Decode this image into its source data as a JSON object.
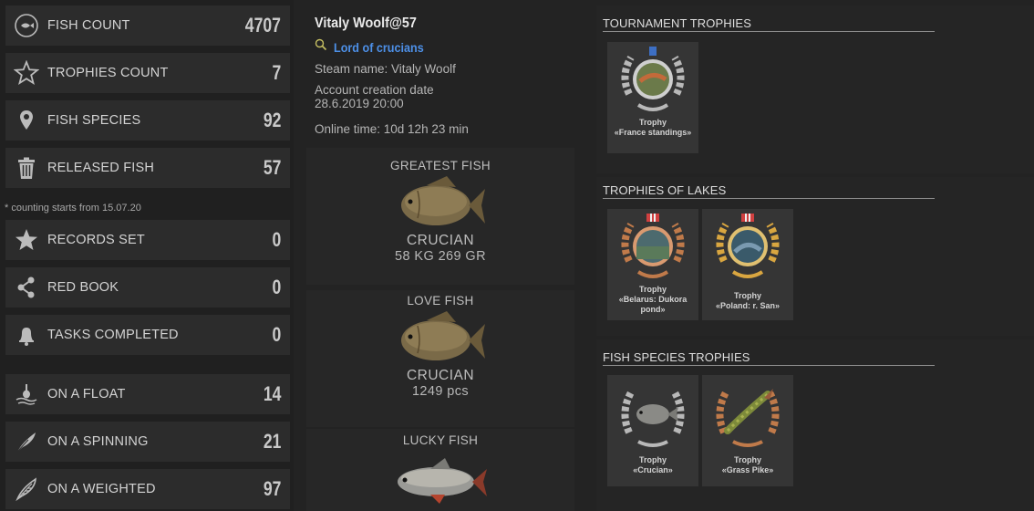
{
  "stats": {
    "fish_count": {
      "label": "FISH COUNT",
      "value": "4707",
      "icon": "fish-icon"
    },
    "trophies_count": {
      "label": "TROPHIES COUNT",
      "value": "7",
      "icon": "star-outline-icon"
    },
    "fish_species": {
      "label": "FISH SPECIES",
      "value": "92",
      "icon": "map-pin-icon"
    },
    "released_fish": {
      "label": "RELEASED FISH",
      "value": "57",
      "icon": "trash-icon"
    },
    "note": "* counting starts from 15.07.20",
    "records_set": {
      "label": "RECORDS SET",
      "value": "0",
      "icon": "star-filled-icon"
    },
    "red_book": {
      "label": "RED BOOK",
      "value": "0",
      "icon": "share-icon"
    },
    "tasks_completed": {
      "label": "TASKS COMPLETED",
      "value": "0",
      "icon": "bell-icon"
    },
    "on_a_float": {
      "label": "ON A FLOAT",
      "value": "14",
      "icon": "float-icon"
    },
    "on_a_spinning": {
      "label": "ON A SPINNING",
      "value": "21",
      "icon": "feather-icon"
    },
    "on_a_weighted": {
      "label": "ON A WEIGHTED",
      "value": "97",
      "icon": "feather-weighted-icon"
    }
  },
  "profile": {
    "name": "Vitaly Woolf@57",
    "title": "Lord of crucians",
    "steam_name": "Steam name: Vitaly Woolf",
    "creation_label": "Account creation date",
    "creation_date": "28.6.2019 20:00",
    "online_time": "Online time: 10d 12h 23 min"
  },
  "fish": {
    "greatest": {
      "caption": "GREATEST FISH",
      "name": "CRUCIAN",
      "amount": "58 KG 269 GR"
    },
    "love": {
      "caption": "LOVE FISH",
      "name": "CRUCIAN",
      "amount": "1249 pcs"
    },
    "lucky": {
      "caption": "LUCKY FISH"
    }
  },
  "trophies": {
    "tournament": {
      "title": "TOURNAMENT TROPHIES",
      "items": [
        {
          "line1": "Trophy",
          "line2": "«France standings»"
        }
      ]
    },
    "lakes": {
      "title": "TROPHIES OF LAKES",
      "items": [
        {
          "line1": "Trophy",
          "line2": "«Belarus: Dukora pond»"
        },
        {
          "line1": "Trophy",
          "line2": "«Poland: r. San»"
        }
      ]
    },
    "species": {
      "title": "FISH SPECIES TROPHIES",
      "items": [
        {
          "line1": "Trophy",
          "line2": "«Crucian»"
        },
        {
          "line1": "Trophy",
          "line2": "«Grass Pike»"
        }
      ]
    }
  },
  "colors": {
    "accent_blue": "#4d90e8",
    "gold": "#d9a640",
    "bronze": "#c07a4a",
    "silver": "#b8b8b8"
  }
}
